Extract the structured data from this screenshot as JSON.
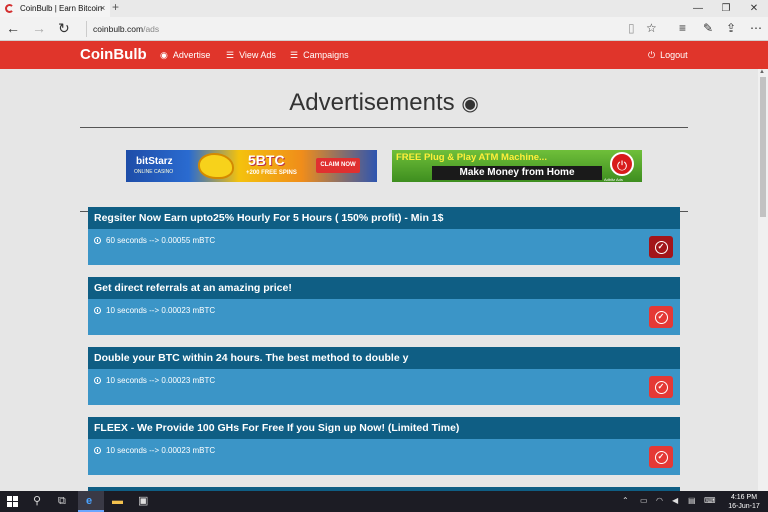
{
  "browser": {
    "tab_title": "CoinBulb | Earn Bitcoin -",
    "tab_close": "×",
    "new_tab": "+",
    "url_host": "coinbulb.com",
    "url_path": "/ads",
    "window_controls": [
      "—",
      "❐",
      "✕"
    ]
  },
  "navbar": {
    "logo": "CoinBulb",
    "items": [
      {
        "label": "Advertise",
        "icon": "eye-icon"
      },
      {
        "label": "View Ads",
        "icon": "list-icon"
      },
      {
        "label": "Campaigns",
        "icon": "list-icon"
      }
    ],
    "logout": "Logout"
  },
  "page": {
    "title": "Advertisements",
    "title_icon": "eye-icon"
  },
  "banners": {
    "bitstarz": {
      "brand": "bitStarz",
      "sub": "ONLINE CASINO",
      "headline": "5BTC",
      "spins": "+200 FREE SPINS",
      "cta": "CLAIM NOW"
    },
    "atm": {
      "headline": "FREE Plug & Play ATM Machine...",
      "tagline": "Make Money from Home",
      "badge": "Adbitz Ads"
    }
  },
  "ads": [
    {
      "title": "Regsiter Now Earn upto25% Hourly For 5 Hours ( 150% profit) - Min 1$",
      "meta": "60 seconds --> 0.00055 mBTC",
      "visited": true
    },
    {
      "title": "Get direct referrals at an amazing price!",
      "meta": "10 seconds --> 0.00023 mBTC",
      "visited": false
    },
    {
      "title": "Double your BTC within 24 hours. The best method to double y",
      "meta": "10 seconds --> 0.00023 mBTC",
      "visited": false
    },
    {
      "title": "FLEEX - We Provide 100 GHs For Free If you Sign up Now! (Limited Time)",
      "meta": "10 seconds --> 0.00023 mBTC",
      "visited": false
    }
  ],
  "taskbar": {
    "time": "4:16 PM",
    "date": "16-Jun-17"
  },
  "colors": {
    "navbar": "#e0352b",
    "ad_header": "#0f5e84",
    "ad_body": "#3b95c7",
    "view_button": "#e53935",
    "view_button_visited": "#a3151a"
  }
}
